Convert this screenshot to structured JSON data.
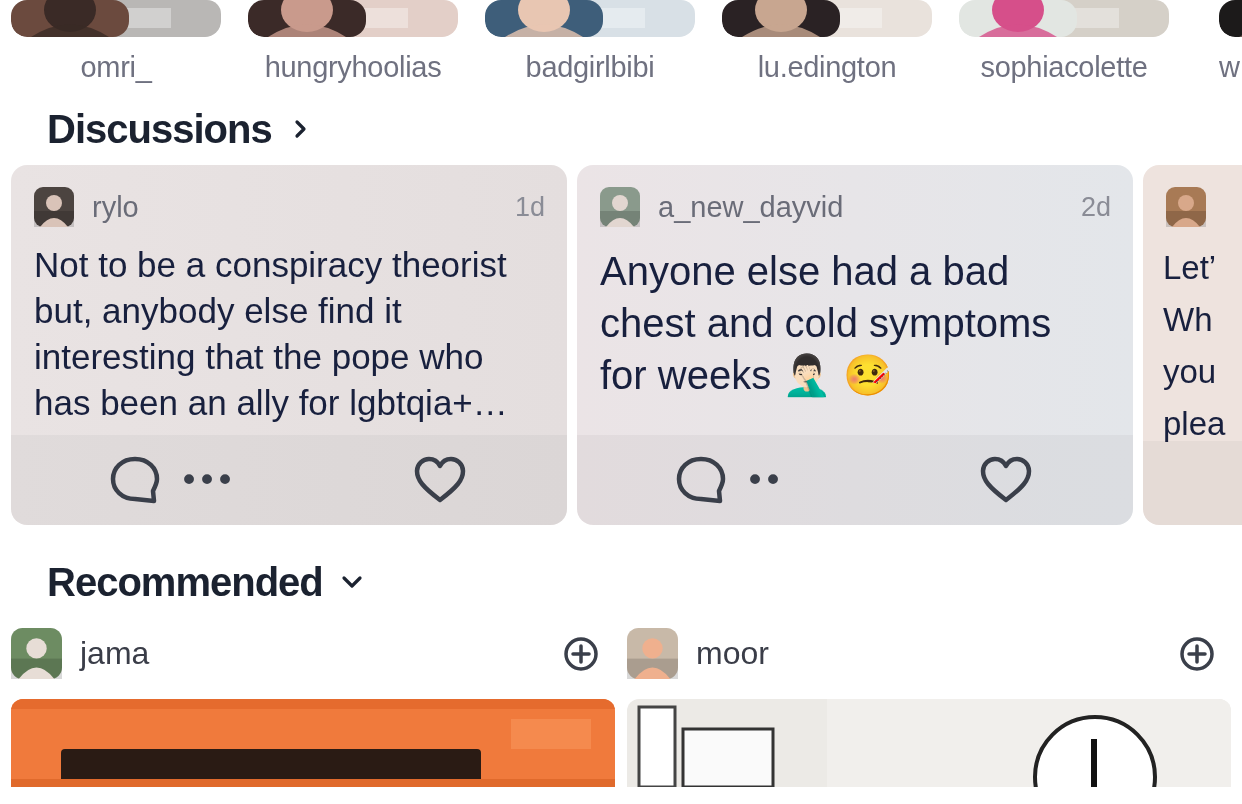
{
  "stories": [
    {
      "username": "omri_"
    },
    {
      "username": "hungryhoolias"
    },
    {
      "username": "badgirlbibi"
    },
    {
      "username": "lu.edington"
    },
    {
      "username": "sophiacolette"
    },
    {
      "username": "w"
    }
  ],
  "discussions": {
    "title": "Discussions",
    "posts": [
      {
        "username": "rylo",
        "age": "1d",
        "text": "Not to be a conspiracy theorist\nbut, anybody else find it\ninteresting that the pope who\nhas been an ally for lgbtqia+…",
        "dots": "•••"
      },
      {
        "username": "a_new_dayvid",
        "age": "2d",
        "text": "Anyone else had a bad\nchest and cold symptoms\nfor weeks 🤦🏻‍♂️ 🤒",
        "dots": "••"
      },
      {
        "text": "Let’\nWh\nyou\nplea"
      }
    ]
  },
  "recommended": {
    "title": "Recommended",
    "items": [
      {
        "username": "jama"
      },
      {
        "username": "moor"
      }
    ]
  }
}
